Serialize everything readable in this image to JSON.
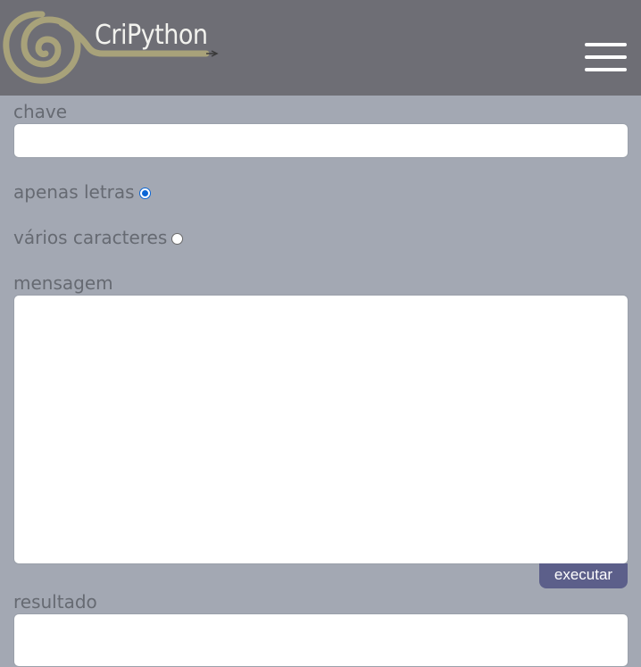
{
  "header": {
    "brand": "CriPython",
    "logo_icon": "spiral-snake-logo",
    "menu_icon": "hamburger-menu-icon"
  },
  "form": {
    "key_label": "chave",
    "key_value": "",
    "option_letters_label": "apenas letras",
    "option_letters_checked": true,
    "option_chars_label": "vários caracteres",
    "option_chars_checked": false,
    "message_label": "mensagem",
    "message_value": "",
    "execute_label": "executar",
    "result_label": "resultado",
    "result_value": ""
  },
  "colors": {
    "header_bg": "#6e6e75",
    "page_bg": "#a3a8b3",
    "logo_gold": "#a8a27a",
    "button_bg": "#5c5f8a",
    "radio_accent": "#0a66d6"
  }
}
